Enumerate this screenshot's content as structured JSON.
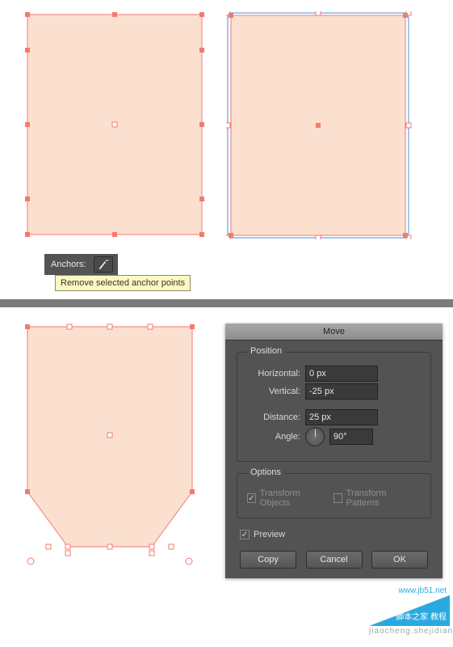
{
  "anchors": {
    "label": "Anchors:",
    "tooltip": "Remove selected anchor points"
  },
  "move": {
    "title": "Move",
    "position": {
      "caption": "Position",
      "horizontal_label": "Horizontal:",
      "horizontal_value": "0 px",
      "vertical_label": "Vertical:",
      "vertical_value": "-25 px",
      "distance_label": "Distance:",
      "distance_value": "25 px",
      "angle_label": "Angle:",
      "angle_value": "90°"
    },
    "options": {
      "caption": "Options",
      "transform_objects": "Transform Objects",
      "transform_patterns": "Transform Patterns"
    },
    "preview_label": "Preview",
    "buttons": {
      "copy": "Copy",
      "cancel": "Cancel",
      "ok": "OK"
    }
  },
  "watermark": {
    "site": "www.jb51.net",
    "cn_line": "脚本之家 教程",
    "sub": "jiaocheng.shejidian.com"
  },
  "colors": {
    "shape_fill": "#fbe0d0",
    "shape_stroke": "#f37a6e",
    "panel_bg": "#535353"
  }
}
